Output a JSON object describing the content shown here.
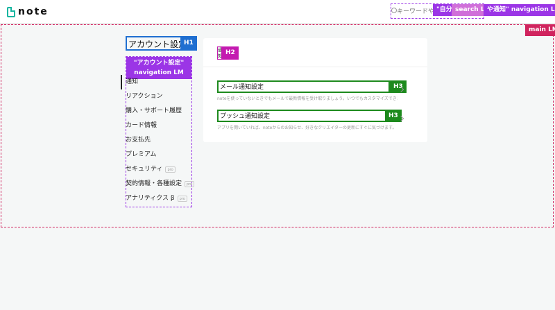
{
  "header": {
    "logo_text": "note",
    "search_placeholder": "キーワードや"
  },
  "sidebar": {
    "title": "アカウント設定",
    "items": [
      {
        "label": "通知",
        "pro": ""
      },
      {
        "label": "リアクション",
        "pro": ""
      },
      {
        "label": "購入・サポート履歴",
        "pro": ""
      },
      {
        "label": "カード情報",
        "pro": ""
      },
      {
        "label": "お支払先",
        "pro": ""
      },
      {
        "label": "プレミアム",
        "pro": ""
      },
      {
        "label": "セキュリティ",
        "pro": "pro"
      },
      {
        "label": "契約情報・各種設定",
        "pro": "pro"
      },
      {
        "label": "アナリティクス β",
        "pro": "pro"
      }
    ]
  },
  "main": {
    "heading": "通知",
    "rows": [
      {
        "title": "メール通知設定",
        "desc": "noteを使っていないときでもメールで最新情報を受け取りましょう。いつでもカスタマイズできます。"
      },
      {
        "title": "プッシュ通知設定",
        "desc": "アプリを開いていれば、noteからのお知らせ、好きなクリエイターの更新にすぐに気づけます。"
      }
    ]
  },
  "landmarks": {
    "search": "search LM",
    "nav_header": "\"自分の記事や通知\" navigation LM",
    "nav_header_short": "\"自分\"",
    "nav_header_tail": "や通知\" navigation LM",
    "main": "main LM",
    "nav_account": "\"アカウント設定\" navigation LM",
    "h1": "H1",
    "h2": "H2",
    "h3": "H3"
  },
  "colors": {
    "brand": "#16b5a0",
    "banner": "#e08a00",
    "main_lm": "#d0245e",
    "nav_lm": "#9b35e6",
    "search_lm": "#d06fd9",
    "h1": "#1f6fd1",
    "h2": "#c41ab0",
    "h3": "#1d8a1d"
  }
}
